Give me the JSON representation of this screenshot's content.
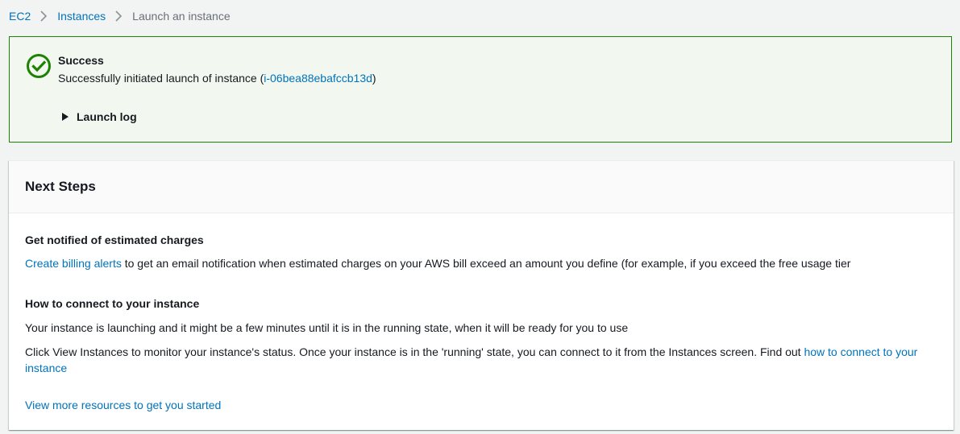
{
  "breadcrumb": {
    "items": [
      "EC2",
      "Instances"
    ],
    "current": "Launch an instance"
  },
  "flash": {
    "title": "Success",
    "message_prefix": "Successfully initiated launch of instance (",
    "instance_id": "i-06bea88ebafccb13d",
    "message_suffix": ")",
    "launch_log_label": "Launch log",
    "icon": "check-circle-icon",
    "color": "#1d8102"
  },
  "next_steps": {
    "title": "Next Steps",
    "billing": {
      "heading": "Get notified of estimated charges",
      "link": "Create billing alerts",
      "text": " to get an email notification when estimated charges on your AWS bill exceed an amount you define (for example, if you exceed the free usage tier"
    },
    "connect": {
      "heading": "How to connect to your instance",
      "text1": "Your instance is launching and it might be a few minutes until it is in the running state, when it will be ready for you to use",
      "text2": "Click View Instances to monitor your instance's status. Once your instance is in the 'running' state, you can connect to it from the Instances screen. Find out ",
      "link": "how to connect to your instance"
    },
    "more_link": "View more resources to get you started"
  },
  "colors": {
    "link": "#0073bb",
    "success": "#1d8102",
    "flash_bg": "#f2f8f0"
  }
}
